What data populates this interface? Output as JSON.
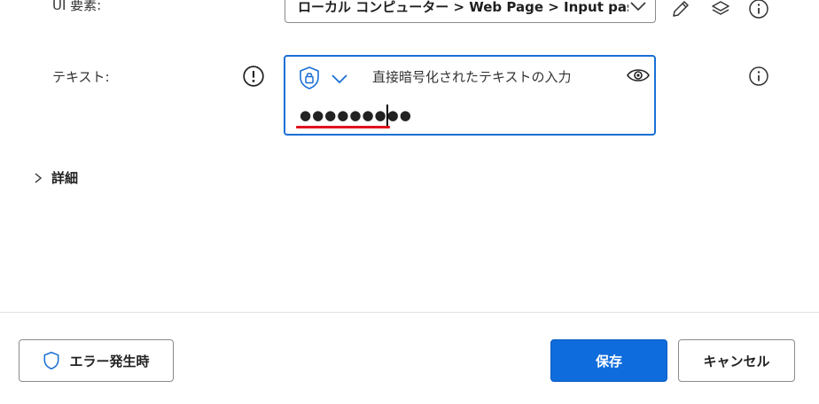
{
  "ui_element": {
    "label": "UI 要素:",
    "value": "ローカル コンピューター > Web Page > Input passv"
  },
  "text_row": {
    "label": "テキスト:",
    "mode_text": "直接暗号化されたテキストの入力",
    "password_value": "●●●●●●●●●"
  },
  "details": {
    "label": "詳細"
  },
  "footer": {
    "on_error_label": "エラー発生時",
    "save_label": "保存",
    "cancel_label": "キャンセル"
  },
  "colors": {
    "accent": "#0f6cdc",
    "field_focus_border": "#1a6fd6",
    "spellcheck_underline": "#e0141e"
  },
  "icons": {
    "ui_select_chevron": "chevron-down-icon",
    "edit": "pencil-icon",
    "layers": "layers-icon",
    "info": "info-icon",
    "warning": "exclamation-circle-icon",
    "lock_shield": "shield-lock-icon",
    "mode_chevron": "chevron-down-icon",
    "show_password": "eye-icon",
    "details_chevron": "chevron-right-icon",
    "on_error": "shield-icon"
  }
}
